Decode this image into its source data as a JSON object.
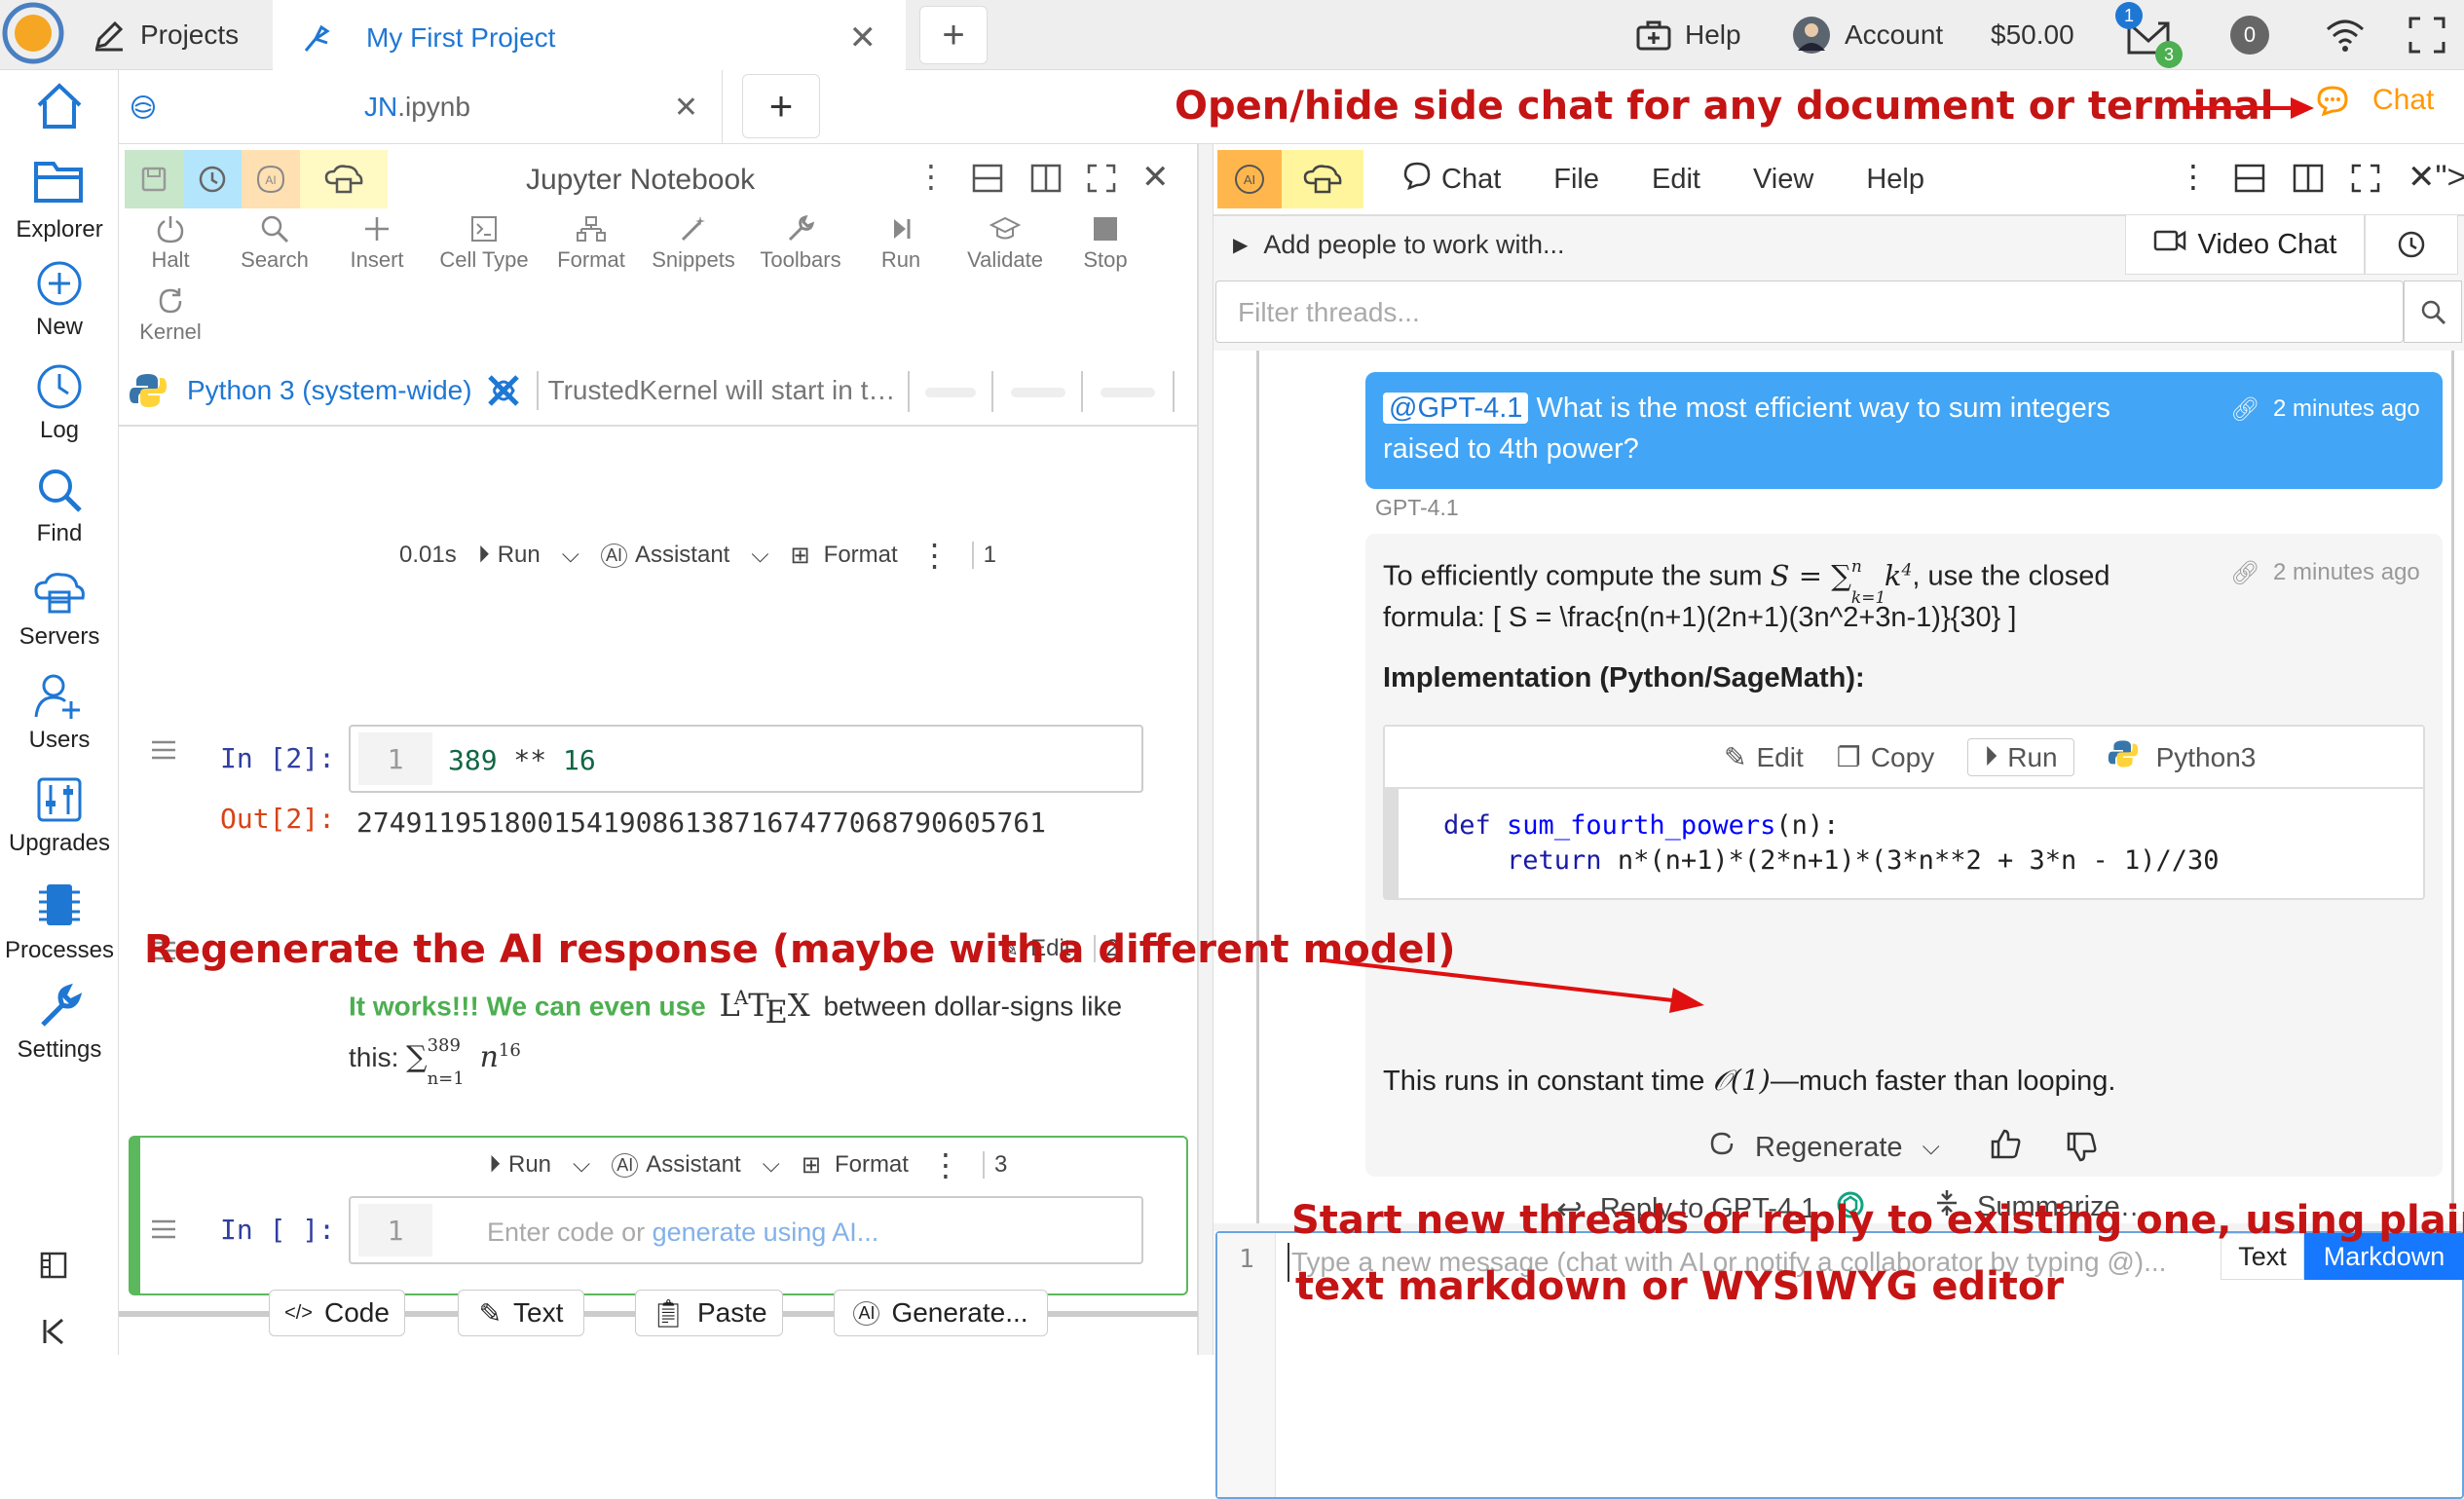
{
  "topbar": {
    "projects_label": "Projects",
    "active_tab_label": "My First Project",
    "help_label": "Help",
    "account_label": "Account",
    "balance": "$50.00",
    "mail_badge_top": "1",
    "mail_badge_bottom": "3",
    "notifications_count": "0"
  },
  "sidebar": {
    "items": [
      {
        "label": "Explorer"
      },
      {
        "label": "New"
      },
      {
        "label": "Log"
      },
      {
        "label": "Find"
      },
      {
        "label": "Servers"
      },
      {
        "label": "Users"
      },
      {
        "label": "Upgrades"
      },
      {
        "label": "Processes"
      },
      {
        "label": "Settings"
      }
    ]
  },
  "filetab": {
    "name_prefix": "JN",
    "name_suffix": ".ipynb",
    "chat_label": "Chat"
  },
  "notebook": {
    "title": "Jupyter Notebook",
    "toolbar": [
      "Halt",
      "Search",
      "Insert",
      "Cell Type",
      "Format",
      "Snippets",
      "Toolbars",
      "Run",
      "Validate",
      "Stop"
    ],
    "kernel_btn": "Kernel",
    "kernel_name": "Python 3 (system-wide)",
    "kernel_status": "TrustedKernel will start in t…",
    "cell1": {
      "time": "0.01s",
      "run": "Run",
      "assistant": "Assistant",
      "format": "Format",
      "number": "1",
      "in_prompt": "In [2]:",
      "line_no": "1",
      "code_num1": "389",
      "code_op": " ** ",
      "code_num2": "16",
      "out_prompt": "Out[2]:",
      "output": "274911951800154190861387167477068790605761"
    },
    "cell2": {
      "edit": "Edit",
      "number": "2",
      "green_text": "It works!!! We can even use",
      "latex": "LATEX",
      "text_after": "between dollar-signs like",
      "text_line2": "this:",
      "math_sum": "∑",
      "math_top": "389",
      "math_bottom": "n=1",
      "math_n": "n",
      "math_exp": "16"
    },
    "cell3": {
      "run": "Run",
      "assistant": "Assistant",
      "format": "Format",
      "number": "3",
      "in_prompt": "In [ ]:",
      "line_no": "1",
      "placeholder_a": "Enter code or ",
      "placeholder_b": "generate using AI..."
    },
    "insert_bar": [
      "Code",
      "Text",
      "Paste",
      "Generate..."
    ]
  },
  "chat": {
    "menu": [
      "Chat",
      "File",
      "Edit",
      "View",
      "Help"
    ],
    "add_people": "Add people to work with...",
    "video_chat": "Video Chat",
    "filter_placeholder": "Filter threads...",
    "user_msg": {
      "mention": "@GPT-4.1",
      "text": "What is the most efficient way to sum integers raised to 4th power?",
      "time": "2 minutes ago"
    },
    "sender_name": "GPT-4.1",
    "ai_msg": {
      "intro_a": "To efficiently compute the sum",
      "intro_math": "S = ∑",
      "intro_math_top": "n",
      "intro_math_bottom": "k=1",
      "intro_math_k": "k",
      "intro_math_exp": "4",
      "intro_b": ", use the closed",
      "formula": "formula: [ S = \\frac{n(n+1)(2n+1)(3n^2+3n-1)}{30} ]",
      "time": "2 minutes ago",
      "heading": "Implementation (Python/SageMath):",
      "code_actions": [
        "Edit",
        "Copy",
        "Run",
        "Python3"
      ],
      "code_line1_kw": "def",
      "code_line1_fn": "sum_fourth_powers",
      "code_line1_rest": "(n):",
      "code_line2_kw": "return",
      "code_line2_rest": " n*(n+1)*(2*n+1)*(3*n**2 + 3*n - 1)//30",
      "footer_a": "This runs in constant time ",
      "footer_math": "𝒪(1)",
      "footer_b": "—much faster than looping.",
      "regenerate": "Regenerate"
    },
    "reply_label": "Reply to GPT-4.1",
    "summarize_label": "Summarize…",
    "input": {
      "line_no": "1",
      "placeholder": "Type a new message (chat with AI or notify a collaborator by typing @)...",
      "mode_text": "Text",
      "mode_markdown": "Markdown"
    }
  },
  "annotations": {
    "top": "Open/hide side chat for any document or terminal",
    "middle": "Regenerate the AI response (maybe with a different model)",
    "bottom_line1": "Start new threads or reply to existing one, using plain",
    "bottom_line2": "text markdown or WYSIWYG editor"
  },
  "colors": {
    "accent_blue": "#1f77d4",
    "user_bubble": "#42a5f5",
    "annotation_red": "#c41414",
    "active_cell_green": "#5cb85c",
    "chat_orange": "#ff9800"
  }
}
